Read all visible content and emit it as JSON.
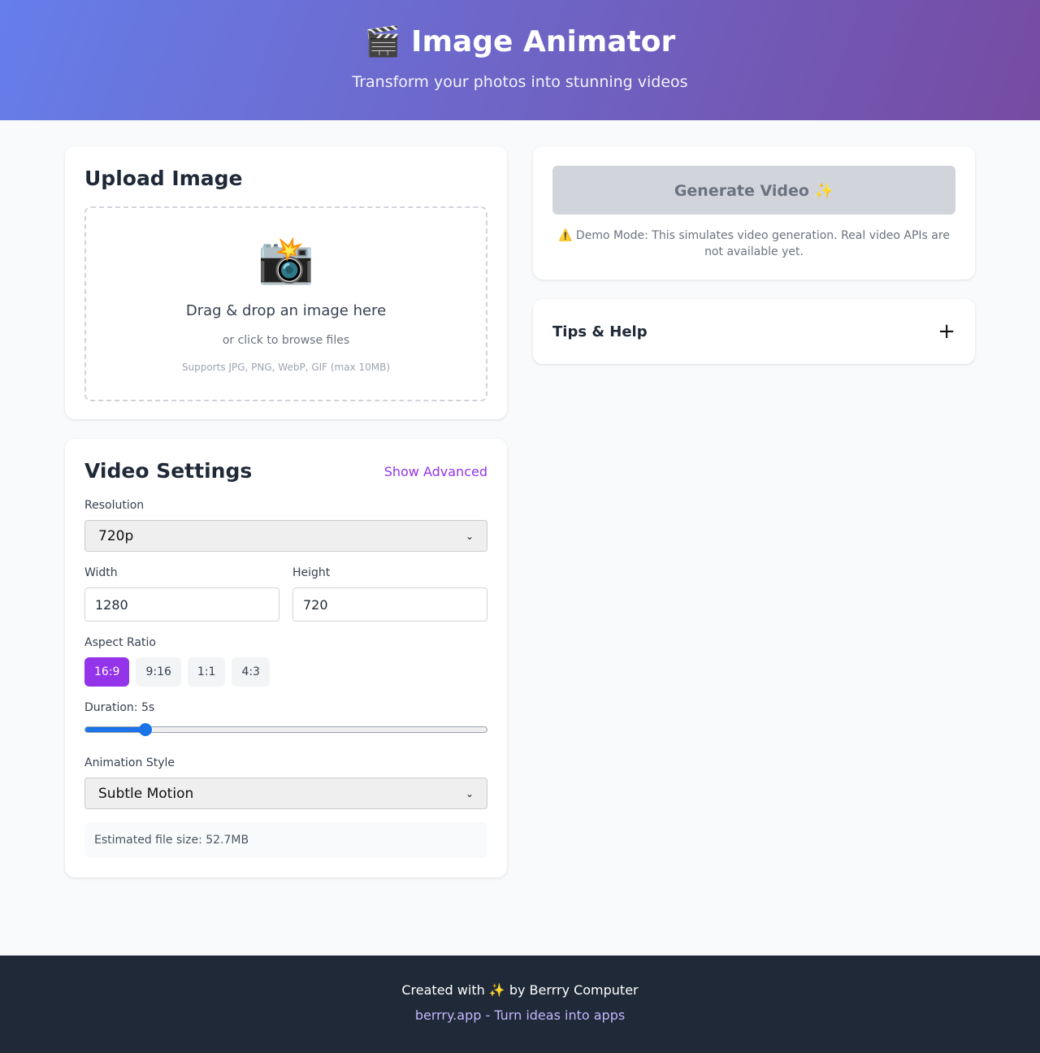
{
  "header": {
    "title": "🎬 Image Animator",
    "subtitle": "Transform your photos into stunning videos"
  },
  "upload": {
    "title": "Upload Image",
    "icon": "📸",
    "primary_text": "Drag & drop an image here",
    "secondary_text": "or click to browse files",
    "formats_text": "Supports JPG, PNG, WebP, GIF (max 10MB)"
  },
  "settings": {
    "title": "Video Settings",
    "advanced_toggle": "Show Advanced",
    "resolution_label": "Resolution",
    "resolution_value": "720p",
    "width_label": "Width",
    "width_value": "1280",
    "height_label": "Height",
    "height_value": "720",
    "aspect_label": "Aspect Ratio",
    "aspect_options": [
      "16:9",
      "9:16",
      "1:1",
      "4:3"
    ],
    "aspect_selected": "16:9",
    "duration_label": "Duration: 5s",
    "duration_fraction": 0.15,
    "animation_label": "Animation Style",
    "animation_value": "Subtle Motion",
    "estimate_text": "Estimated file size: 52.7MB"
  },
  "generate": {
    "button_label": "Generate Video ✨",
    "demo_note": "⚠️ Demo Mode: This simulates video generation. Real video APIs are not available yet."
  },
  "tips": {
    "title": "Tips & Help",
    "toggle_icon": "+"
  },
  "footer": {
    "credit": "Created with ✨ by Berrry Computer",
    "link": "berrry.app - Turn ideas into apps"
  },
  "colors": {
    "accent": "#9333ea",
    "slider": "#1a73e8",
    "footer_bg": "#1f2937",
    "link": "#c4b5fd"
  }
}
